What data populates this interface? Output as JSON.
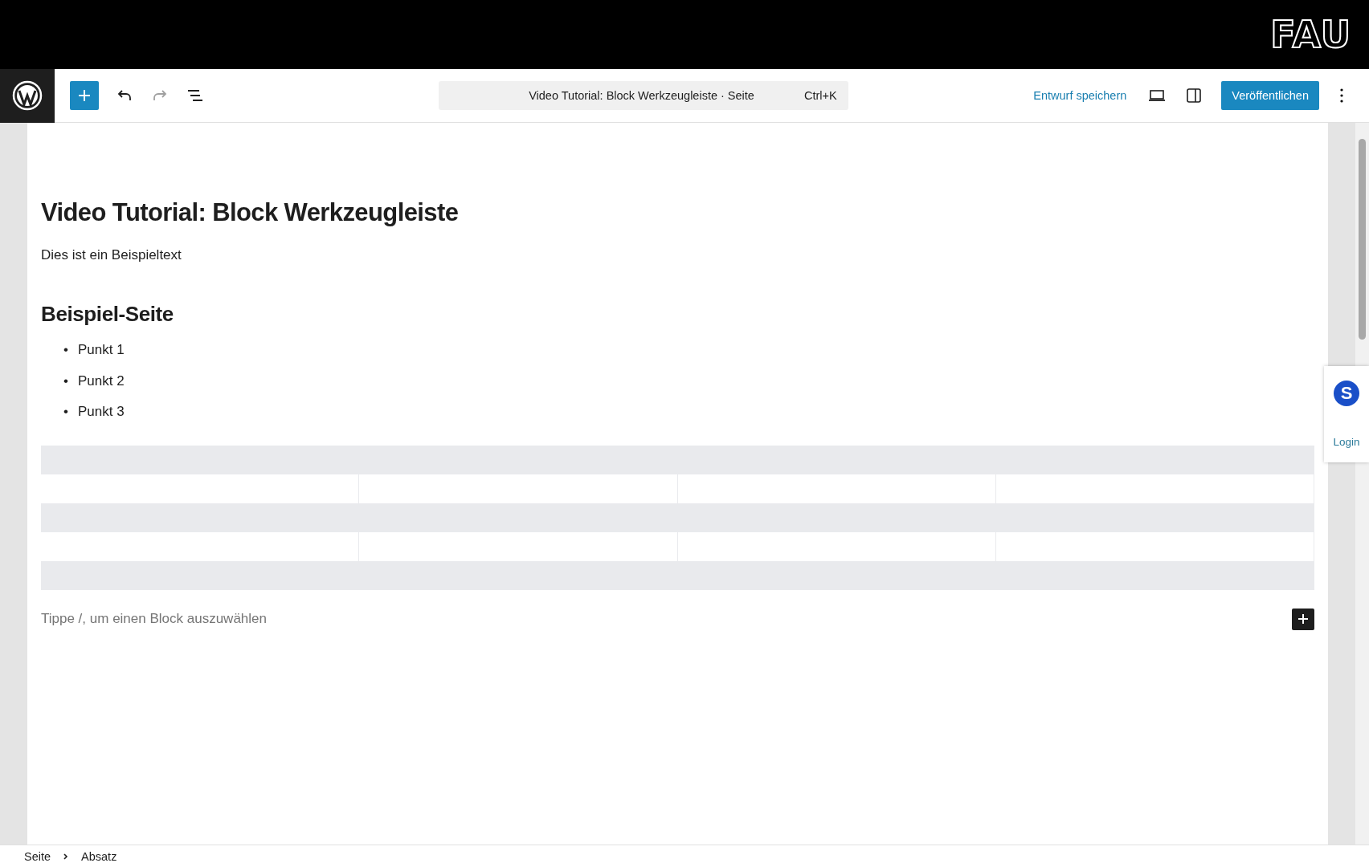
{
  "top_bar": {
    "logo": "FAU"
  },
  "toolbar": {
    "command_title": "Video Tutorial: Block Werkzeugleiste · Seite",
    "shortcut": "Ctrl+K",
    "save_draft": "Entwurf speichern",
    "publish": "Veröffentlichen"
  },
  "content": {
    "title": "Video Tutorial: Block Werkzeugleiste",
    "paragraph": "Dies ist ein Beispieltext",
    "heading": "Beispiel-Seite",
    "list": [
      {
        "marker": "•",
        "text": "Punkt 1"
      },
      {
        "marker": "•",
        "text": "Punkt 2"
      },
      {
        "marker": "•",
        "text": "Punkt 3"
      }
    ],
    "placeholder": "Tippe /, um einen Block auszuwählen"
  },
  "side_widget": {
    "badge": "S",
    "login": "Login"
  },
  "breadcrumb": [
    "Seite",
    "Absatz"
  ]
}
